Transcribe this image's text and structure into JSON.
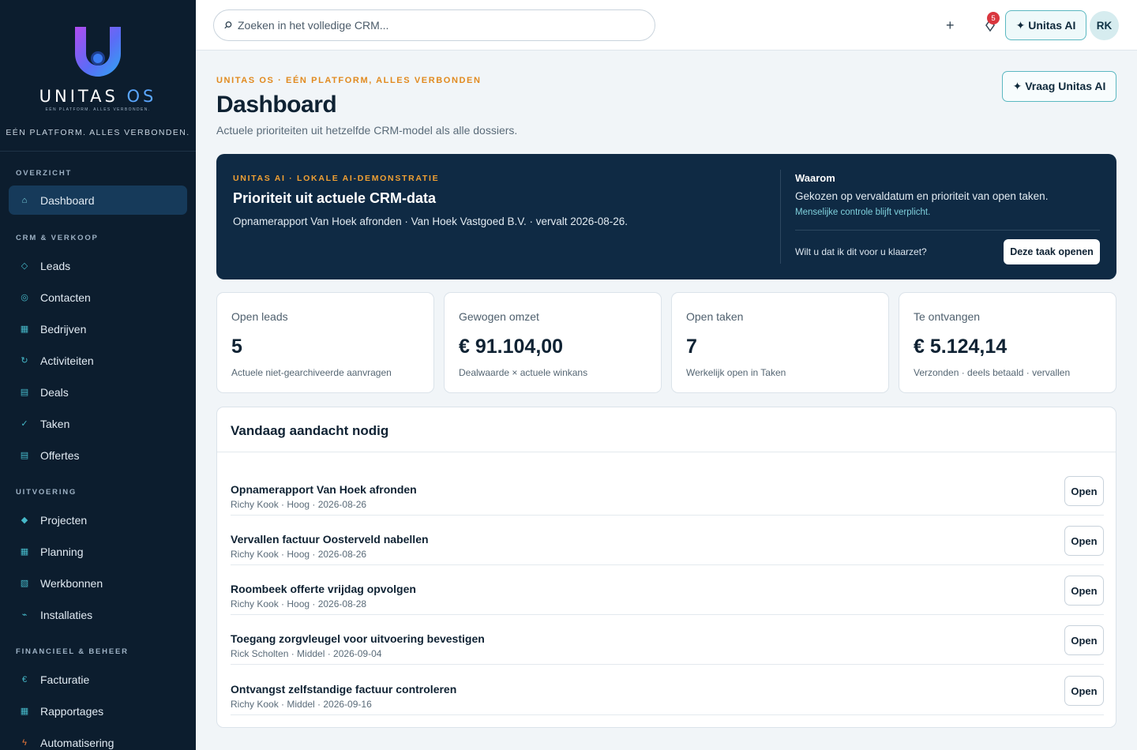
{
  "brand": {
    "name_main": "UNITAS",
    "name_accent": "OS",
    "logo_subtitle": "EÉN PLATFORM. ALLES VERBONDEN.",
    "tagline": "EÉN PLATFORM. ALLES VERBONDEN."
  },
  "sidebar": {
    "sections": [
      {
        "label": "OVERZICHT"
      },
      {
        "label": "CRM & VERKOOP"
      },
      {
        "label": "UITVOERING"
      },
      {
        "label": "FINANCIEEL & BEHEER"
      }
    ],
    "items": [
      {
        "label": "Dashboard",
        "icon": "home-icon",
        "glyph": "⌂",
        "active": true
      },
      {
        "label": "Leads",
        "icon": "diamond-outline-icon",
        "glyph": "◇"
      },
      {
        "label": "Contacten",
        "icon": "contact-icon",
        "glyph": "◎"
      },
      {
        "label": "Bedrijven",
        "icon": "building-icon",
        "glyph": "▦"
      },
      {
        "label": "Activiteiten",
        "icon": "activity-icon",
        "glyph": "↻"
      },
      {
        "label": "Deals",
        "icon": "deals-icon",
        "glyph": "▤"
      },
      {
        "label": "Taken",
        "icon": "check-icon",
        "glyph": "✓"
      },
      {
        "label": "Offertes",
        "icon": "quote-icon",
        "glyph": "▤"
      },
      {
        "label": "Projecten",
        "icon": "project-icon",
        "glyph": "◆"
      },
      {
        "label": "Planning",
        "icon": "calendar-icon",
        "glyph": "▦"
      },
      {
        "label": "Werkbonnen",
        "icon": "workorder-icon",
        "glyph": "▧"
      },
      {
        "label": "Installaties",
        "icon": "installation-icon",
        "glyph": "⌁"
      },
      {
        "label": "Facturatie",
        "icon": "euro-icon",
        "glyph": "€"
      },
      {
        "label": "Rapportages",
        "icon": "report-icon",
        "glyph": "▦"
      },
      {
        "label": "Automatisering",
        "icon": "lightning-icon",
        "glyph": "ϟ"
      }
    ]
  },
  "topbar": {
    "search_placeholder": "Zoeken in het volledige CRM...",
    "plus_label": "+",
    "notification_count": "5",
    "ai_button": "✦ Unitas AI",
    "avatar_initials": "RK"
  },
  "header": {
    "eyebrow": "UNITAS OS · EÉN PLATFORM, ALLES VERBONDEN",
    "title": "Dashboard",
    "subtitle": "Actuele prioriteiten uit hetzelfde CRM-model als alle dossiers.",
    "ask_ai_button": "✦ Vraag Unitas AI"
  },
  "ai_banner": {
    "eyebrow": "UNITAS AI · LOKALE AI-DEMONSTRATIE",
    "title": "Prioriteit uit actuele CRM-data",
    "description": "Opnamerapport Van Hoek afronden · Van Hoek Vastgoed B.V. · vervalt 2026-08-26.",
    "why_label": "Waarom",
    "why_text": "Gekozen op vervaldatum en prioriteit van open taken.",
    "why_note": "Menselijke controle blijft verplicht.",
    "question": "Wilt u dat ik dit voor u klaarzet?",
    "action_button": "Deze taak openen"
  },
  "stats": [
    {
      "label": "Open leads",
      "value": "5",
      "note": "Actuele niet-gearchiveerde aanvragen"
    },
    {
      "label": "Gewogen omzet",
      "value": "€ 91.104,00",
      "note": "Dealwaarde × actuele winkans"
    },
    {
      "label": "Open taken",
      "value": "7",
      "note": "Werkelijk open in Taken"
    },
    {
      "label": "Te ontvangen",
      "value": "€ 5.124,14",
      "note": "Verzonden · deels betaald · vervallen"
    }
  ],
  "attention": {
    "title": "Vandaag aandacht nodig",
    "open_label": "Open",
    "tasks": [
      {
        "title": "Opnamerapport Van Hoek afronden",
        "meta": "Richy Kook · Hoog · 2026-08-26"
      },
      {
        "title": "Vervallen factuur Oosterveld nabellen",
        "meta": "Richy Kook · Hoog · 2026-08-26"
      },
      {
        "title": "Roombeek offerte vrijdag opvolgen",
        "meta": "Richy Kook · Hoog · 2026-08-28"
      },
      {
        "title": "Toegang zorgvleugel voor uitvoering bevestigen",
        "meta": "Rick Scholten · Middel · 2026-09-04"
      },
      {
        "title": "Ontvangst zelfstandige factuur controleren",
        "meta": "Richy Kook · Middel · 2026-09-16"
      }
    ]
  },
  "colors": {
    "sidebar_bg": "#0c1d2e",
    "accent_orange": "#e18a1f",
    "accent_teal": "#46b9c9",
    "banner_bg": "#0f2a44",
    "badge_red": "#d9363e"
  }
}
